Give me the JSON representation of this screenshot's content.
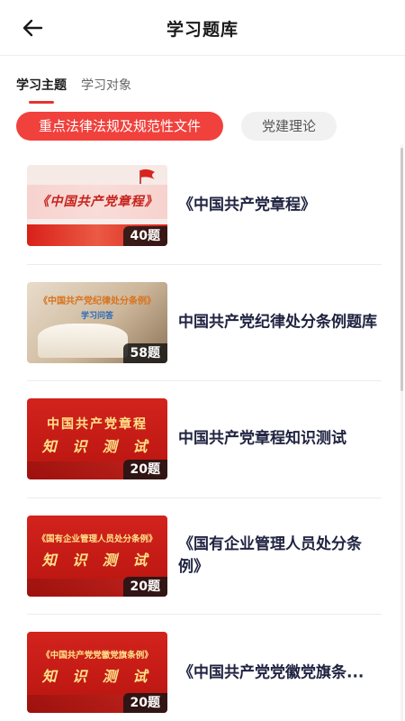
{
  "header": {
    "title": "学习题库",
    "back_icon": "back-arrow-icon"
  },
  "tabs": [
    {
      "label": "学习主题",
      "active": true
    },
    {
      "label": "学习对象",
      "active": false
    }
  ],
  "categories": [
    {
      "label": "重点法律法规及规范性文件",
      "selected": true
    },
    {
      "label": "党建理论",
      "selected": false
    }
  ],
  "items": [
    {
      "title": "《中国共产党章程》",
      "count": "40题",
      "thumb_text": "《中国共产党章程》"
    },
    {
      "title": "中国共产党纪律处分条例题库",
      "count": "58题",
      "thumb_text": "《中国共产党纪律处分条例》",
      "thumb_sub": "学习问答"
    },
    {
      "title": "中国共产党章程知识测试",
      "count": "20题",
      "thumb_text": "中国共产党章程",
      "thumb_sub": "知 识 测 试"
    },
    {
      "title": "《国有企业管理人员处分条例》",
      "count": "20题",
      "thumb_text": "《国有企业管理人员处分条例》",
      "thumb_sub": "知 识 测 试"
    },
    {
      "title": "《中国共产党党徽党旗条...",
      "count": "20题",
      "thumb_text": "《中国共产党党徽党旗条例》",
      "thumb_sub": "知 识 测 试"
    }
  ],
  "colors": {
    "accent": "#f0413d",
    "title_text": "#1f2340",
    "thumb_red": "#c81d18"
  }
}
